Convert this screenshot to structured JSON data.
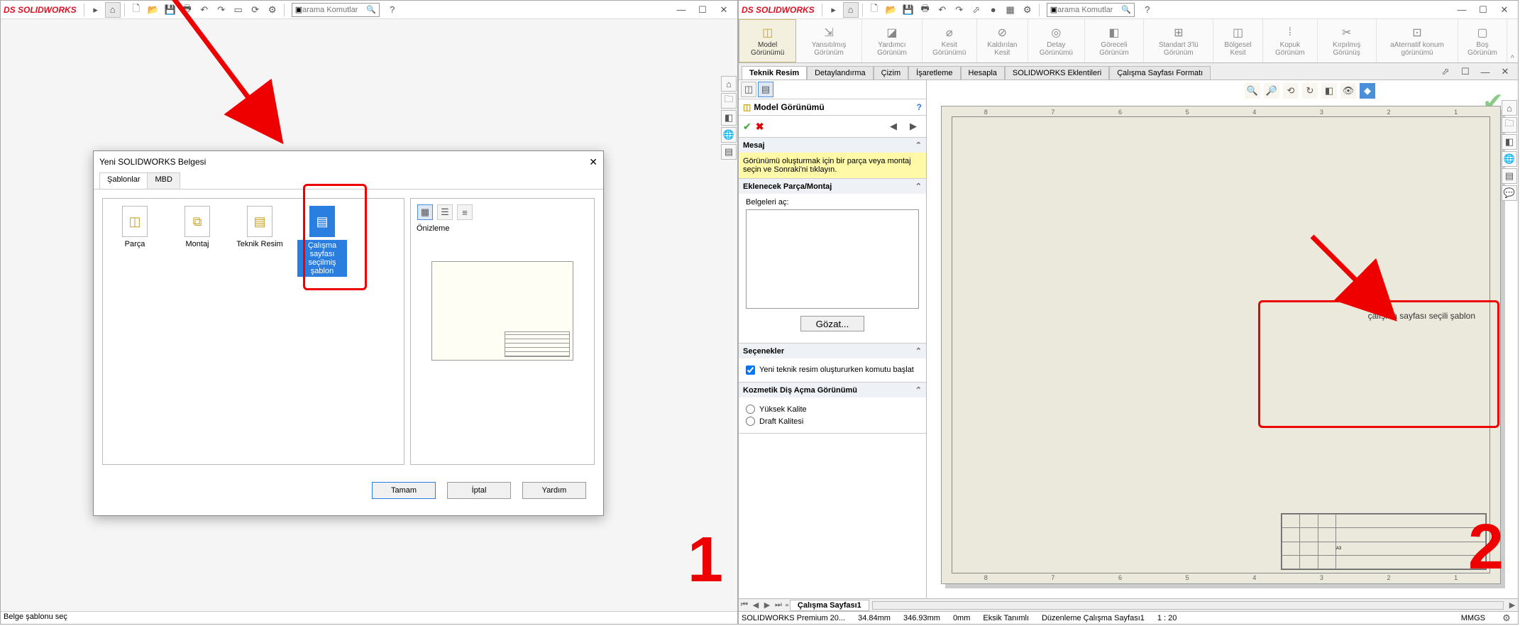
{
  "pane1": {
    "app_logo": "SOLIDWORKS",
    "search_placeholder": "arama Komutlar",
    "statusbar": "Belge şablonu seç",
    "dialog": {
      "title": "Yeni SOLIDWORKS Belgesi",
      "tabs": [
        "Şablonlar",
        "MBD"
      ],
      "templates": [
        {
          "label": "Parça"
        },
        {
          "label": "Montaj"
        },
        {
          "label": "Teknik Resim"
        },
        {
          "label": "Çalışma sayfası seçilmiş şablon",
          "selected": true
        }
      ],
      "preview_label": "Önizleme",
      "buttons": {
        "ok": "Tamam",
        "cancel": "İptal",
        "help": "Yardım"
      }
    },
    "big_number": "1"
  },
  "pane2": {
    "app_logo": "SOLIDWORKS",
    "search_placeholder": "arama Komutlar",
    "ribbon": [
      {
        "label": "Model Görünümü",
        "active": true
      },
      {
        "label": "Yansıtılmış Görünüm"
      },
      {
        "label": "Yardımcı Görünüm"
      },
      {
        "label": "Kesit Görünümü"
      },
      {
        "label": "Kaldırılan Kesit"
      },
      {
        "label": "Detay Görünümü"
      },
      {
        "label": "Göreceli Görünüm"
      },
      {
        "label": "Standart 3'lü Görünüm"
      },
      {
        "label": "Bölgesel Kesit"
      },
      {
        "label": "Kopuk Görünüm"
      },
      {
        "label": "Kırpılmış Görünüş"
      },
      {
        "label": "aAternatif konum görünümü"
      },
      {
        "label": "Boş Görünüm"
      }
    ],
    "tabs": [
      "Teknik Resim",
      "Detaylandırma",
      "Çizim",
      "İşaretleme",
      "Hesapla",
      "SOLIDWORKS Eklentileri",
      "Çalışma Sayfası Formatı"
    ],
    "prop": {
      "title": "Model Görünümü",
      "sections": {
        "mesaj": {
          "header": "Mesaj",
          "body": "Görünümü oluşturmak için bir parça veya montaj seçin ve Sonraki'ni tıklayın."
        },
        "parca": {
          "header": "Eklenecek Parça/Montaj",
          "label": "Belgeleri aç:",
          "browse": "Gözat..."
        },
        "secenek": {
          "header": "Seçenekler",
          "checkbox": "Yeni teknik resim oluştururken komutu başlat"
        },
        "kozmetik": {
          "header": "Kozmetik Diş Açma Görünümü",
          "r1": "Yüksek Kalite",
          "r2": "Draft Kalitesi"
        }
      }
    },
    "canvas": {
      "annotation": "çalışma sayfası seçili şablon"
    },
    "sheet_tab": "Çalışma Sayfası1",
    "status": {
      "app": "SOLIDWORKS Premium 20...",
      "dim1": "34.84mm",
      "dim2": "346.93mm",
      "dim3": "0mm",
      "defn": "Eksik Tanımlı",
      "edit": "Düzenleme Çalışma Sayfası1",
      "scale": "1 : 20",
      "units": "MMGS"
    },
    "big_number": "2"
  }
}
